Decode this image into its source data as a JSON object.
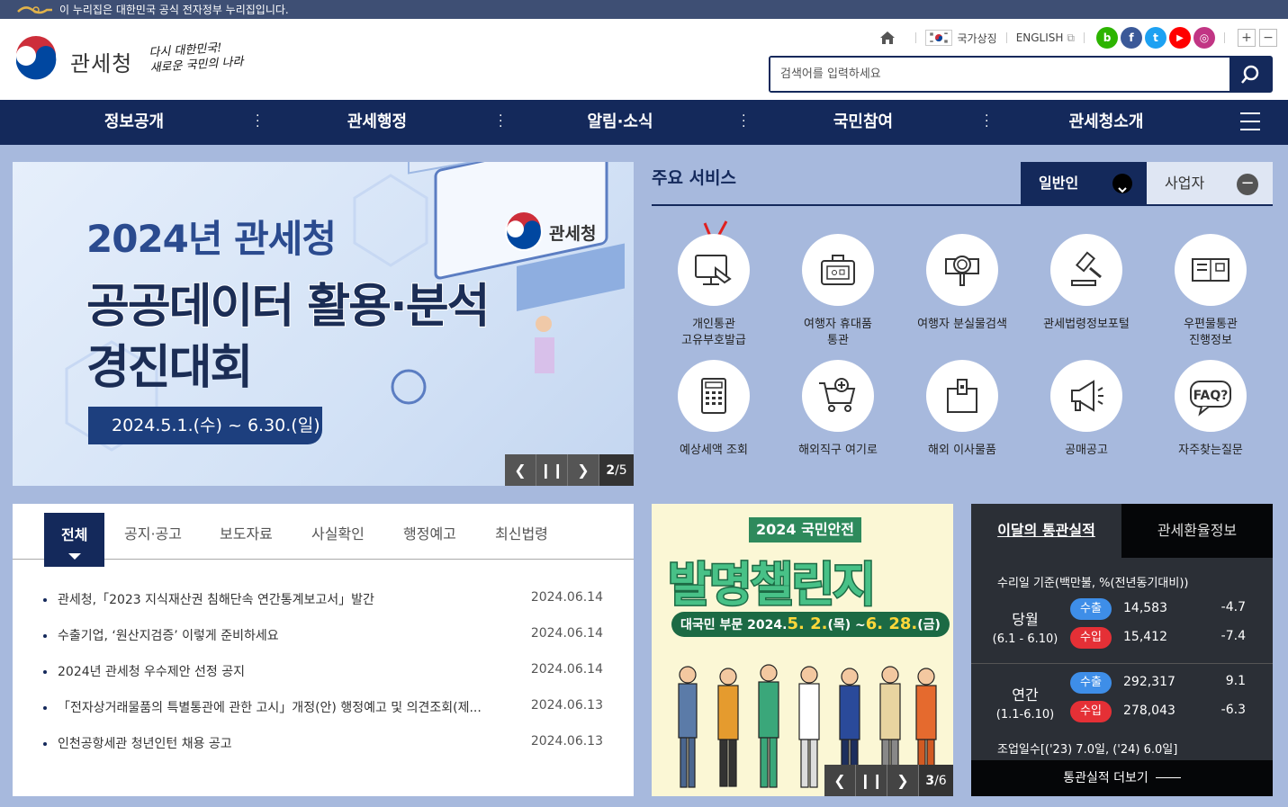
{
  "gov_banner": {
    "text": "이 누리집은 대한민국 공식 전자정부 누리집입니다."
  },
  "header": {
    "agency_name": "관세청",
    "slogan_line1": "다시 대한민국!",
    "slogan_line2": "새로운 국민의 나라",
    "util": {
      "national_symbol": "국가상징",
      "english": "ENGLISH"
    },
    "sns": [
      {
        "name": "blog",
        "label": "b",
        "color": "#2db400"
      },
      {
        "name": "facebook",
        "label": "f",
        "color": "#3b5998"
      },
      {
        "name": "twitter",
        "label": "t",
        "color": "#1da1f2"
      },
      {
        "name": "youtube",
        "label": "▶",
        "color": "#ff0000"
      },
      {
        "name": "instagram",
        "label": "◎",
        "color": "#c13584"
      }
    ],
    "search_placeholder": "검색어를 입력하세요"
  },
  "gnb": {
    "items": [
      "정보공개",
      "관세행정",
      "알림·소식",
      "국민참여",
      "관세청소개"
    ]
  },
  "main_banner": {
    "line1": "2024년 관세청",
    "line2": "공공데이터 활용·분석",
    "line3": "경진대회",
    "date": "2024.5.1.(수) ~ 6.30.(일)",
    "logo_text": "관세청",
    "counter_current": "2",
    "counter_total": "/5"
  },
  "services": {
    "title": "주요 서비스",
    "tab_general": "일반인",
    "tab_business": "사업자",
    "items": [
      {
        "label": "개인통관\n고유부호발급",
        "icon": "monitor-hand-icon"
      },
      {
        "label": "여행자 휴대품\n통관",
        "icon": "suitcase-icon"
      },
      {
        "label": "여행자 분실물검색",
        "icon": "magnifier-box-icon"
      },
      {
        "label": "관세법령정보포털",
        "icon": "gavel-icon"
      },
      {
        "label": "우편물통관\n진행정보",
        "icon": "mail-icon"
      },
      {
        "label": "예상세액 조회",
        "icon": "calculator-icon"
      },
      {
        "label": "해외직구 여기로",
        "icon": "cart-icon"
      },
      {
        "label": "해외 이사물품",
        "icon": "box-icon"
      },
      {
        "label": "공매공고",
        "icon": "megaphone-icon"
      },
      {
        "label": "자주찾는질문",
        "icon": "faq-icon"
      }
    ]
  },
  "news": {
    "tabs": [
      "전체",
      "공지·공고",
      "보도자료",
      "사실확인",
      "행정예고",
      "최신법령"
    ],
    "items": [
      {
        "title": "관세청,「2023 지식재산권 침해단속 연간통계보고서」발간",
        "date": "2024.06.14"
      },
      {
        "title": "수출기업, ‘원산지검증’ 이렇게 준비하세요",
        "date": "2024.06.14"
      },
      {
        "title": "2024년 관세청 우수제안 선정 공지",
        "date": "2024.06.14"
      },
      {
        "title": "「전자상거래물품의 특별통관에 관한 고시」개정(안) 행정예고 및 의견조회(제...",
        "date": "2024.06.13"
      },
      {
        "title": "인천공항세관 청년인턴 채용 공고",
        "date": "2024.06.13"
      }
    ]
  },
  "promo": {
    "year_label": "2024 국민안전",
    "title": "발명챌린지",
    "sub_prefix": "대국민 부문 2024.",
    "sub_start": "5. 2.",
    "sub_mid": "(목) ~",
    "sub_end": "6. 28.",
    "sub_suffix": "(금)",
    "counter_current": "3",
    "counter_total": "/6"
  },
  "stats": {
    "tab_active": "이달의 통관실적",
    "tab_other": "관세환율정보",
    "unit": "수리일 기준(백만불, %(전년동기대비))",
    "current": {
      "name": "당월",
      "range": "(6.1 - 6.10)",
      "export_label": "수출",
      "export_value": "14,583",
      "export_change": "-4.7",
      "import_label": "수입",
      "import_value": "15,412",
      "import_change": "-7.4"
    },
    "annual": {
      "name": "연간",
      "range": "(1.1-6.10)",
      "export_label": "수출",
      "export_value": "292,317",
      "export_change": "9.1",
      "import_label": "수입",
      "import_value": "278,043",
      "import_change": "-6.3"
    },
    "clearance_days": "조업일수[('23) 7.0일, ('24) 6.0일]",
    "more": "통관실적 더보기"
  }
}
